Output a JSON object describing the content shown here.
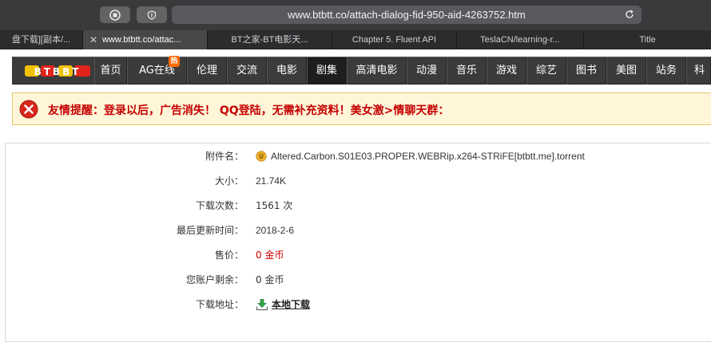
{
  "browser": {
    "url": "www.btbtt.co/attach-dialog-fid-950-aid-4263752.htm",
    "tabs": [
      {
        "label": "盘下载][副本/..."
      },
      {
        "label": "www.btbtt.co/attac..."
      },
      {
        "label": "BT之家-BT电影天..."
      },
      {
        "label": "Chapter 5. Fluent API"
      },
      {
        "label": "TeslaCN/learning-r..."
      },
      {
        "label": "Title"
      }
    ],
    "close_glyph": "✕"
  },
  "site": {
    "logo_text": "BTBBT",
    "nav": [
      "首页",
      "AG在线",
      "伦理",
      "交流",
      "电影",
      "剧集",
      "高清电影",
      "动漫",
      "音乐",
      "游戏",
      "综艺",
      "图书",
      "美图",
      "站务",
      "科"
    ],
    "active_nav": "剧集",
    "hot_badge": "热"
  },
  "notice": {
    "text": "友情提醒：登录以后，广告消失！ QQ登陆，无需补充资料！美女激>情聊天群："
  },
  "attachment": {
    "filename_label": "附件名：",
    "filename": "Altered.Carbon.S01E03.PROPER.WEBRip.x264-STRiFE[btbtt.me].torrent",
    "size_label": "大小：",
    "size": "21.74K",
    "downloads_label": "下载次数：",
    "downloads": "1561 次",
    "updated_label": "最后更新时间：",
    "updated": "2018-2-6",
    "price_label": "售价：",
    "price": "0 金币",
    "balance_label": "您账户剩余：",
    "balance": "0 金币",
    "download_label": "下载地址：",
    "download_link": "本地下载"
  },
  "colors": {
    "notice_text": "#c40000",
    "price": "#d00000",
    "nav_bg": "#3b3b3b"
  },
  "icons": {
    "file": "torrent-file-icon",
    "download": "download-arrow-icon",
    "error": "error-x-icon"
  }
}
